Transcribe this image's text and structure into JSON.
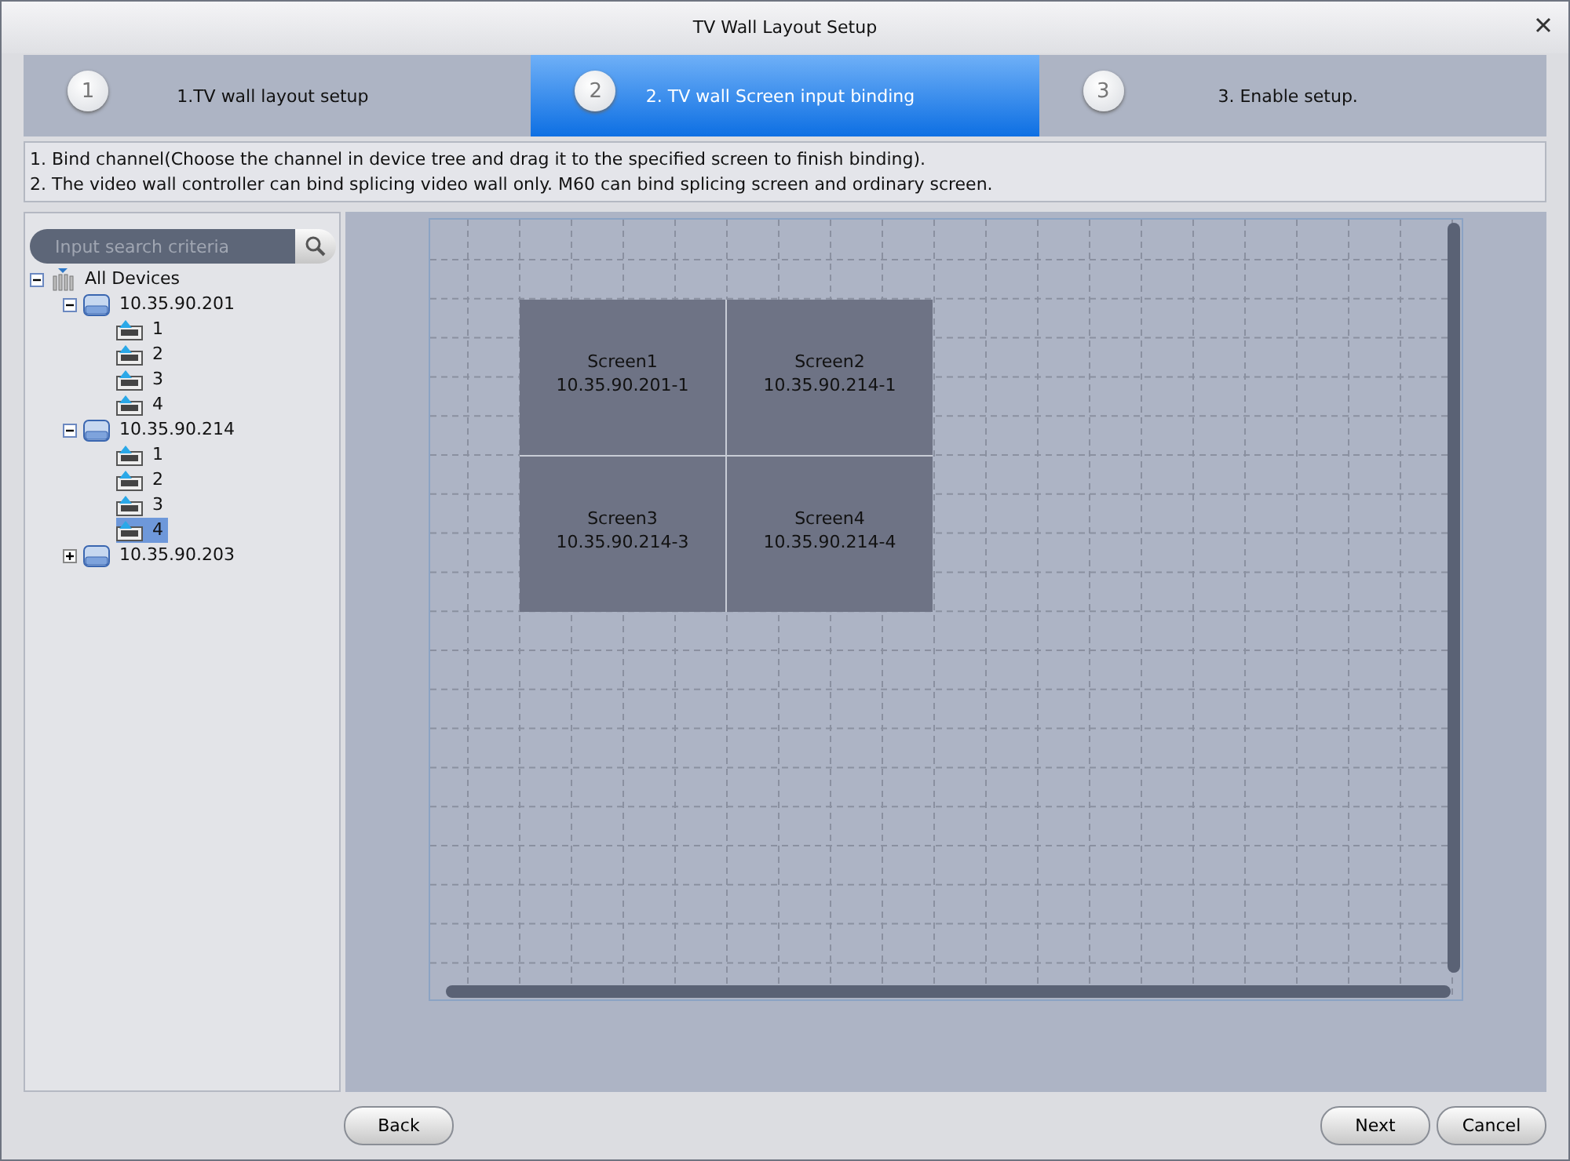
{
  "window": {
    "title": "TV Wall Layout Setup"
  },
  "steps": [
    {
      "number": "1",
      "label": "1.TV wall layout setup",
      "selected": false
    },
    {
      "number": "2",
      "label": "2. TV wall Screen input binding",
      "selected": true
    },
    {
      "number": "3",
      "label": "3. Enable setup.",
      "selected": false
    }
  ],
  "instructions": [
    "1. Bind channel(Choose the channel in device tree and drag it to the specified screen to finish binding).",
    "2. The video wall controller can bind splicing video wall only.  M60 can bind splicing screen and ordinary screen."
  ],
  "search": {
    "placeholder": "Input search criteria"
  },
  "tree": [
    {
      "kind": "root",
      "label": "All Devices",
      "expanded": true,
      "selected": false,
      "children": [
        {
          "kind": "device",
          "label": "10.35.90.201",
          "expanded": true,
          "selected": false,
          "children": [
            {
              "kind": "channel",
              "label": "1",
              "selected": false
            },
            {
              "kind": "channel",
              "label": "2",
              "selected": false
            },
            {
              "kind": "channel",
              "label": "3",
              "selected": false
            },
            {
              "kind": "channel",
              "label": "4",
              "selected": false
            }
          ]
        },
        {
          "kind": "device",
          "label": "10.35.90.214",
          "expanded": true,
          "selected": false,
          "children": [
            {
              "kind": "channel",
              "label": "1",
              "selected": false
            },
            {
              "kind": "channel",
              "label": "2",
              "selected": false
            },
            {
              "kind": "channel",
              "label": "3",
              "selected": false
            },
            {
              "kind": "channel",
              "label": "4",
              "selected": true
            }
          ]
        },
        {
          "kind": "device",
          "label": "10.35.90.203",
          "expanded": false,
          "selected": false
        }
      ]
    }
  ],
  "screens": [
    {
      "name": "Screen1",
      "binding": "10.35.90.201-1"
    },
    {
      "name": "Screen2",
      "binding": "10.35.90.214-1"
    },
    {
      "name": "Screen3",
      "binding": "10.35.90.214-3"
    },
    {
      "name": "Screen4",
      "binding": "10.35.90.214-4"
    }
  ],
  "buttons": {
    "back": "Back",
    "next": "Next",
    "cancel": "Cancel"
  }
}
